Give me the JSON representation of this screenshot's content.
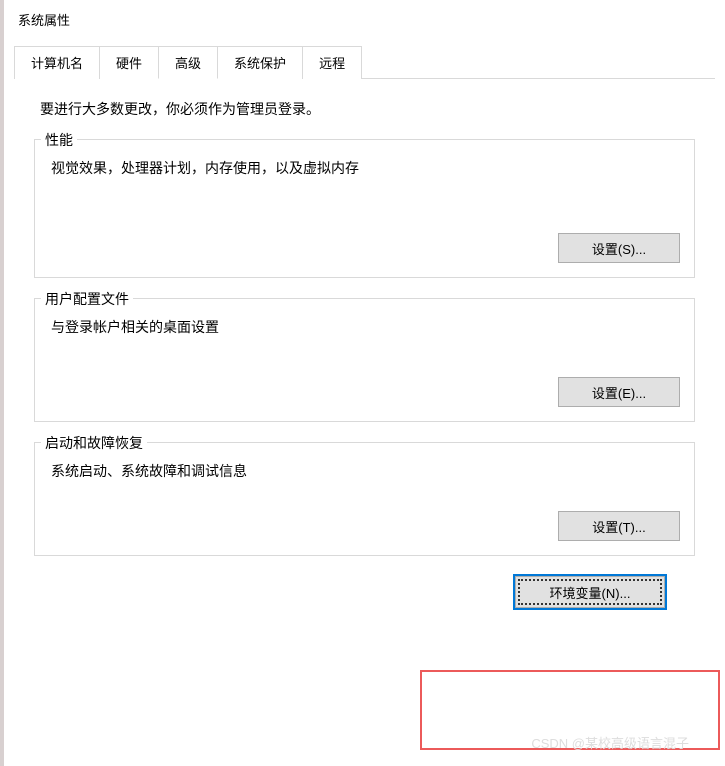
{
  "window": {
    "title": "系统属性"
  },
  "tabs": [
    {
      "label": "计算机名"
    },
    {
      "label": "硬件"
    },
    {
      "label": "高级"
    },
    {
      "label": "系统保护"
    },
    {
      "label": "远程"
    }
  ],
  "intro": "要进行大多数更改，你必须作为管理员登录。",
  "groups": {
    "performance": {
      "title": "性能",
      "desc": "视觉效果，处理器计划，内存使用，以及虚拟内存",
      "button": "设置(S)..."
    },
    "user_profiles": {
      "title": "用户配置文件",
      "desc": "与登录帐户相关的桌面设置",
      "button": "设置(E)..."
    },
    "startup": {
      "title": "启动和故障恢复",
      "desc": "系统启动、系统故障和调试信息",
      "button": "设置(T)..."
    }
  },
  "env_button": "环境变量(N)...",
  "watermark": "CSDN @某校高级语言混子"
}
